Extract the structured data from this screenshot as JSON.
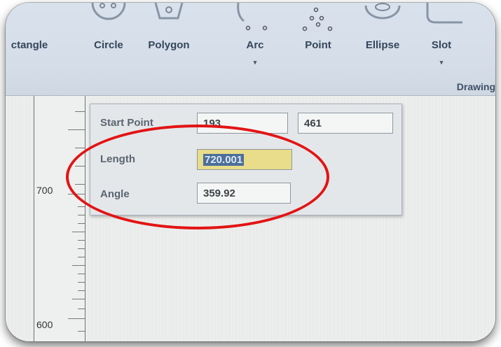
{
  "ribbon": {
    "buttons": [
      {
        "label": "ctangle",
        "icon": "rectangle-icon"
      },
      {
        "label": "Circle",
        "icon": "circle-icon"
      },
      {
        "label": "Polygon",
        "icon": "polygon-icon"
      },
      {
        "label": "Arc",
        "icon": "arc-icon",
        "dropdown": "▾"
      },
      {
        "label": "Point",
        "icon": "point-icon"
      },
      {
        "label": "Ellipse",
        "icon": "ellipse-icon"
      },
      {
        "label": "Slot",
        "icon": "slot-icon",
        "dropdown": "▾"
      }
    ],
    "group_label": "Drawing"
  },
  "ruler": {
    "labels": [
      "700",
      "600"
    ]
  },
  "dialog": {
    "start_point_label": "Start Point",
    "start_x": "193",
    "start_y": "461",
    "length_label": "Length",
    "length_value": "720.001",
    "angle_label": "Angle",
    "angle_value": "359.92"
  },
  "colors": {
    "annotation": "#e21414",
    "ribbon": "#d6dfe9",
    "selection": "#4b6e9a"
  }
}
